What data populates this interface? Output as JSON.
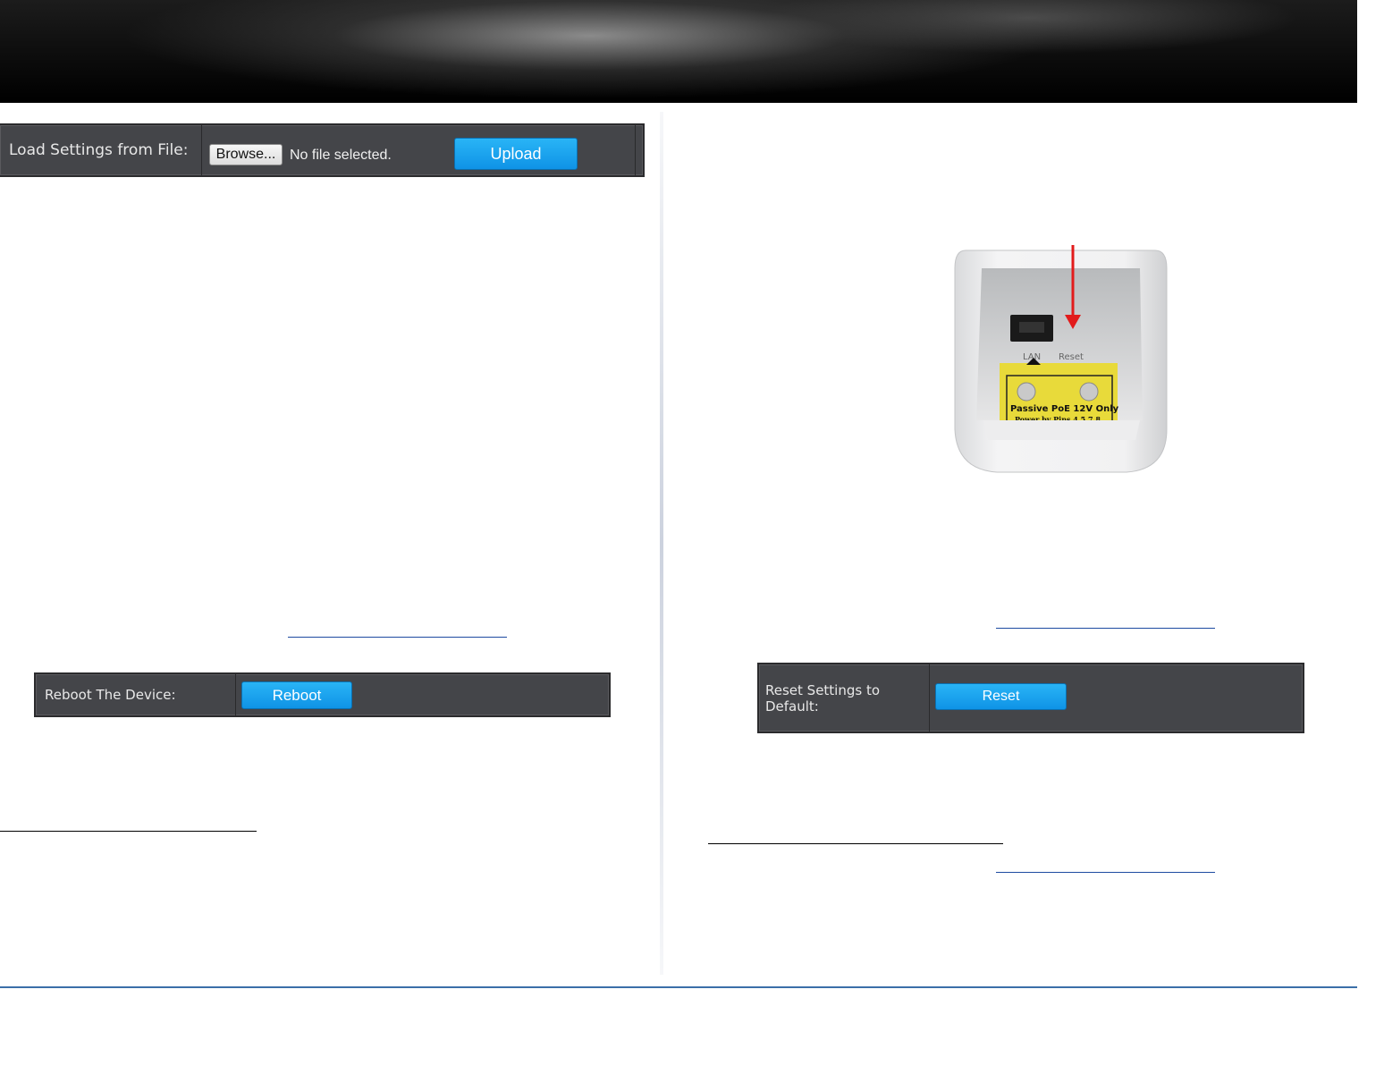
{
  "load_settings": {
    "label": "Load Settings from File:",
    "browse_label": "Browse...",
    "file_status": "No file selected.",
    "upload_label": "Upload"
  },
  "reboot": {
    "label": "Reboot The Device:",
    "button_label": "Reboot"
  },
  "reset": {
    "label": "Reset Settings to Default:",
    "button_label": "Reset"
  },
  "device_photo": {
    "port_label_lan": "LAN",
    "port_label_reset": "Reset",
    "sticker_line1": "Passive PoE 12V Only",
    "sticker_line2": "Power by Pins 4,5,7,8"
  },
  "colors": {
    "panel_bg": "#444549",
    "button_blue": "#1a9fee",
    "footer_rule": "#3b6fa8",
    "arrow_red": "#e21b1b",
    "sticker_yellow": "#e8da3a"
  }
}
